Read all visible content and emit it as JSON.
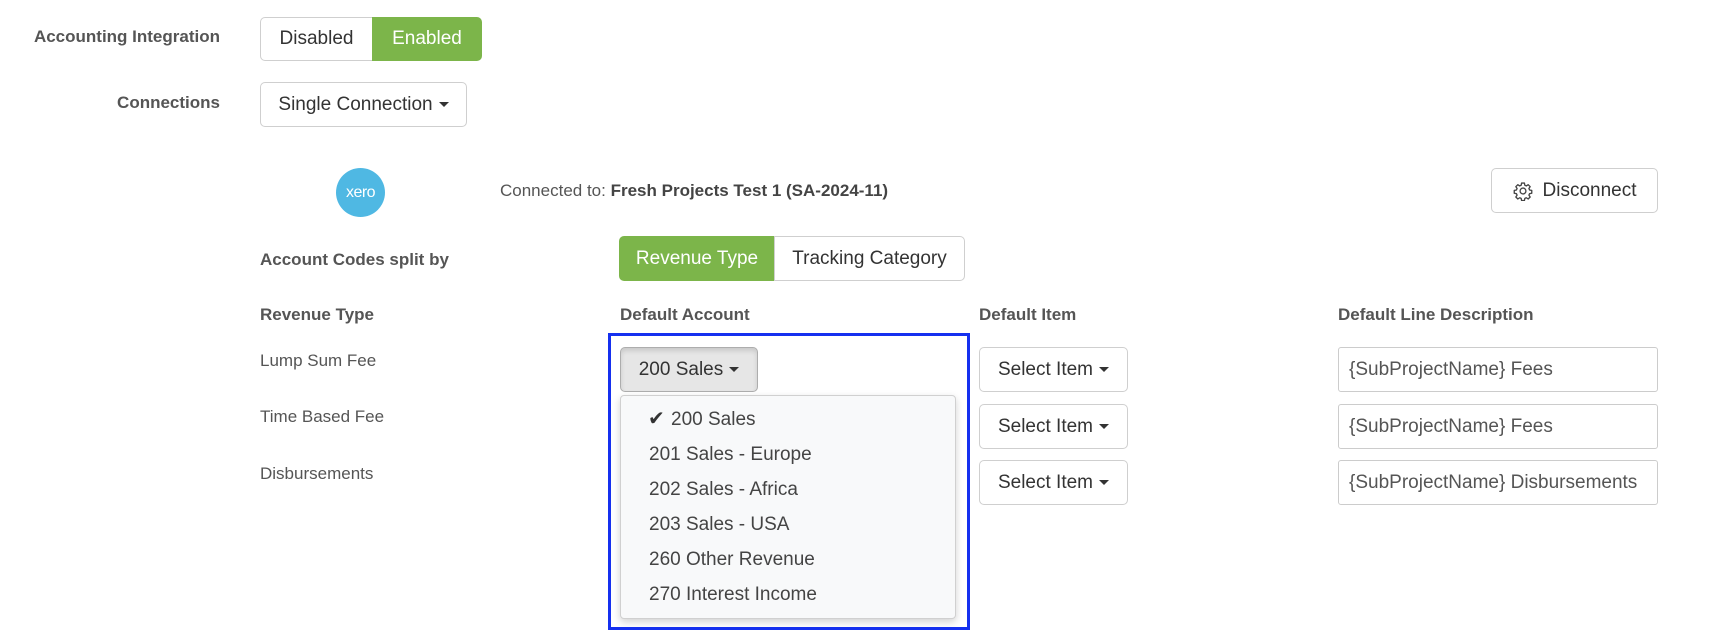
{
  "accounting": {
    "label": "Accounting Integration",
    "options": [
      "Disabled",
      "Enabled"
    ],
    "selected": "Enabled"
  },
  "connections": {
    "label": "Connections",
    "value": "Single Connection"
  },
  "xero": {
    "logo_text": "xero",
    "connected_prefix": "Connected to:",
    "connected_name": "Fresh Projects Test 1 (SA-2024-11)",
    "disconnect_label": "Disconnect"
  },
  "split": {
    "label": "Account Codes split by",
    "options": [
      "Revenue Type",
      "Tracking Category"
    ],
    "selected": "Revenue Type"
  },
  "table": {
    "headers": [
      "Revenue Type",
      "Default Account",
      "Default Item",
      "Default Line Description"
    ],
    "rows": [
      {
        "revenue_type": "Lump Sum Fee",
        "account": "200 Sales",
        "item": "Select Item",
        "description": "{SubProjectName} Fees"
      },
      {
        "revenue_type": "Time Based Fee",
        "account": "",
        "item": "Select Item",
        "description": "{SubProjectName} Fees"
      },
      {
        "revenue_type": "Disbursements",
        "account": "",
        "item": "Select Item",
        "description": "{SubProjectName} Disbursements"
      }
    ]
  },
  "account_dropdown": {
    "selected": "200 Sales",
    "check_glyph": "✔",
    "options": [
      "200 Sales",
      "201 Sales - Europe",
      "202 Sales - Africa",
      "203 Sales - USA",
      "260 Other Revenue",
      "270 Interest Income"
    ]
  },
  "colors": {
    "accent_green": "#7cb54a",
    "xero_blue": "#4fb8e3",
    "highlight_blue": "#1530ef"
  }
}
